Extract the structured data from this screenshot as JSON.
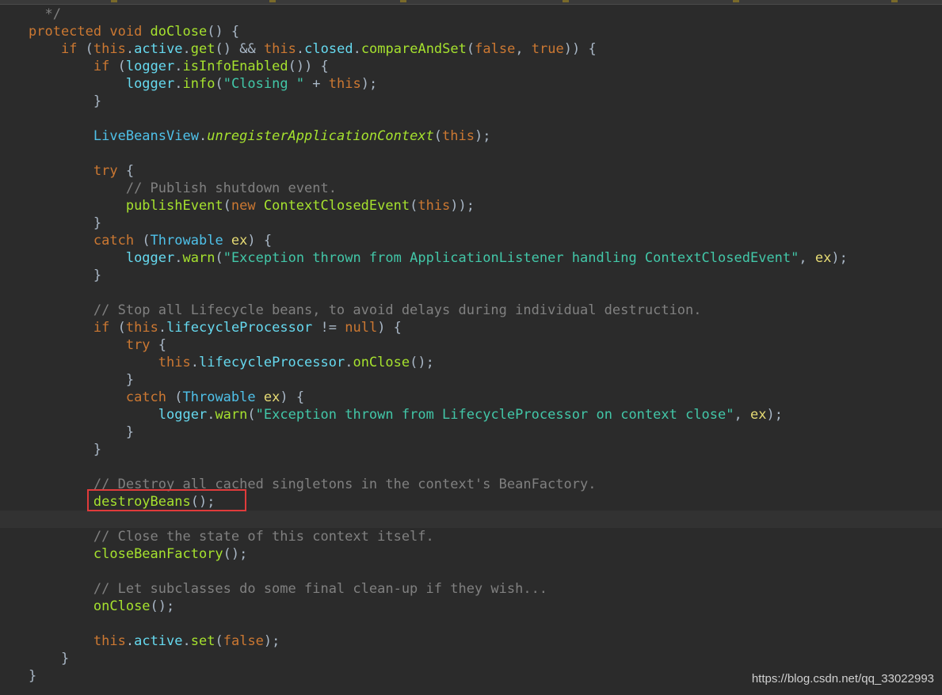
{
  "code_lines": [
    [
      {
        "t": "  */",
        "c": "c"
      }
    ],
    [
      {
        "t": "protected ",
        "c": "k"
      },
      {
        "t": "void ",
        "c": "k"
      },
      {
        "t": "doClose",
        "c": "f"
      },
      {
        "t": "() {",
        "c": "p"
      }
    ],
    [
      {
        "t": "    ",
        "c": "p"
      },
      {
        "t": "if ",
        "c": "k"
      },
      {
        "t": "(",
        "c": "p"
      },
      {
        "t": "this",
        "c": "k"
      },
      {
        "t": ".",
        "c": "p"
      },
      {
        "t": "active",
        "c": "m"
      },
      {
        "t": ".",
        "c": "p"
      },
      {
        "t": "get",
        "c": "f"
      },
      {
        "t": "() && ",
        "c": "p"
      },
      {
        "t": "this",
        "c": "k"
      },
      {
        "t": ".",
        "c": "p"
      },
      {
        "t": "closed",
        "c": "m"
      },
      {
        "t": ".",
        "c": "p"
      },
      {
        "t": "compareAndSet",
        "c": "f"
      },
      {
        "t": "(",
        "c": "p"
      },
      {
        "t": "false",
        "c": "k"
      },
      {
        "t": ", ",
        "c": "p"
      },
      {
        "t": "true",
        "c": "k"
      },
      {
        "t": ")) {",
        "c": "p"
      }
    ],
    [
      {
        "t": "        ",
        "c": "p"
      },
      {
        "t": "if ",
        "c": "k"
      },
      {
        "t": "(",
        "c": "p"
      },
      {
        "t": "logger",
        "c": "m"
      },
      {
        "t": ".",
        "c": "p"
      },
      {
        "t": "isInfoEnabled",
        "c": "f"
      },
      {
        "t": "()) {",
        "c": "p"
      }
    ],
    [
      {
        "t": "            ",
        "c": "p"
      },
      {
        "t": "logger",
        "c": "m"
      },
      {
        "t": ".",
        "c": "p"
      },
      {
        "t": "info",
        "c": "f"
      },
      {
        "t": "(",
        "c": "p"
      },
      {
        "t": "\"Closing \"",
        "c": "s"
      },
      {
        "t": " + ",
        "c": "p"
      },
      {
        "t": "this",
        "c": "k"
      },
      {
        "t": ");",
        "c": "p"
      }
    ],
    [
      {
        "t": "        }",
        "c": "p"
      }
    ],
    [],
    [
      {
        "t": "        ",
        "c": "p"
      },
      {
        "t": "LiveBeansView",
        "c": "t"
      },
      {
        "t": ".",
        "c": "p"
      },
      {
        "t": "unregisterApplicationContext",
        "c": "fi"
      },
      {
        "t": "(",
        "c": "p"
      },
      {
        "t": "this",
        "c": "k"
      },
      {
        "t": ");",
        "c": "p"
      }
    ],
    [],
    [
      {
        "t": "        ",
        "c": "p"
      },
      {
        "t": "try ",
        "c": "k"
      },
      {
        "t": "{",
        "c": "p"
      }
    ],
    [
      {
        "t": "            ",
        "c": "p"
      },
      {
        "t": "// Publish shutdown event.",
        "c": "c"
      }
    ],
    [
      {
        "t": "            ",
        "c": "p"
      },
      {
        "t": "publishEvent",
        "c": "f"
      },
      {
        "t": "(",
        "c": "p"
      },
      {
        "t": "new ",
        "c": "k"
      },
      {
        "t": "ContextClosedEvent",
        "c": "f"
      },
      {
        "t": "(",
        "c": "p"
      },
      {
        "t": "this",
        "c": "k"
      },
      {
        "t": "));",
        "c": "p"
      }
    ],
    [
      {
        "t": "        }",
        "c": "p"
      }
    ],
    [
      {
        "t": "        ",
        "c": "p"
      },
      {
        "t": "catch ",
        "c": "k"
      },
      {
        "t": "(",
        "c": "p"
      },
      {
        "t": "Throwable ",
        "c": "t"
      },
      {
        "t": "ex",
        "c": "v"
      },
      {
        "t": ") {",
        "c": "p"
      }
    ],
    [
      {
        "t": "            ",
        "c": "p"
      },
      {
        "t": "logger",
        "c": "m"
      },
      {
        "t": ".",
        "c": "p"
      },
      {
        "t": "warn",
        "c": "f"
      },
      {
        "t": "(",
        "c": "p"
      },
      {
        "t": "\"Exception thrown from ApplicationListener handling ContextClosedEvent\"",
        "c": "s"
      },
      {
        "t": ", ",
        "c": "p"
      },
      {
        "t": "ex",
        "c": "v"
      },
      {
        "t": ");",
        "c": "p"
      }
    ],
    [
      {
        "t": "        }",
        "c": "p"
      }
    ],
    [],
    [
      {
        "t": "        ",
        "c": "p"
      },
      {
        "t": "// Stop all Lifecycle beans, to avoid delays during individual destruction.",
        "c": "c"
      }
    ],
    [
      {
        "t": "        ",
        "c": "p"
      },
      {
        "t": "if ",
        "c": "k"
      },
      {
        "t": "(",
        "c": "p"
      },
      {
        "t": "this",
        "c": "k"
      },
      {
        "t": ".",
        "c": "p"
      },
      {
        "t": "lifecycleProcessor",
        "c": "m"
      },
      {
        "t": " != ",
        "c": "p"
      },
      {
        "t": "null",
        "c": "k"
      },
      {
        "t": ") {",
        "c": "p"
      }
    ],
    [
      {
        "t": "            ",
        "c": "p"
      },
      {
        "t": "try ",
        "c": "k"
      },
      {
        "t": "{",
        "c": "p"
      }
    ],
    [
      {
        "t": "                ",
        "c": "p"
      },
      {
        "t": "this",
        "c": "k"
      },
      {
        "t": ".",
        "c": "p"
      },
      {
        "t": "lifecycleProcessor",
        "c": "m"
      },
      {
        "t": ".",
        "c": "p"
      },
      {
        "t": "onClose",
        "c": "f"
      },
      {
        "t": "();",
        "c": "p"
      }
    ],
    [
      {
        "t": "            }",
        "c": "p"
      }
    ],
    [
      {
        "t": "            ",
        "c": "p"
      },
      {
        "t": "catch ",
        "c": "k"
      },
      {
        "t": "(",
        "c": "p"
      },
      {
        "t": "Throwable ",
        "c": "t"
      },
      {
        "t": "ex",
        "c": "v"
      },
      {
        "t": ") {",
        "c": "p"
      }
    ],
    [
      {
        "t": "                ",
        "c": "p"
      },
      {
        "t": "logger",
        "c": "m"
      },
      {
        "t": ".",
        "c": "p"
      },
      {
        "t": "warn",
        "c": "f"
      },
      {
        "t": "(",
        "c": "p"
      },
      {
        "t": "\"Exception thrown from LifecycleProcessor on context close\"",
        "c": "s"
      },
      {
        "t": ", ",
        "c": "p"
      },
      {
        "t": "ex",
        "c": "v"
      },
      {
        "t": ");",
        "c": "p"
      }
    ],
    [
      {
        "t": "            }",
        "c": "p"
      }
    ],
    [
      {
        "t": "        }",
        "c": "p"
      }
    ],
    [],
    [
      {
        "t": "        ",
        "c": "p"
      },
      {
        "t": "// Destroy all cached singletons in the context's BeanFactory.",
        "c": "c"
      }
    ],
    [
      {
        "t": "        ",
        "c": "p"
      },
      {
        "t": "destroyBeans",
        "c": "f"
      },
      {
        "t": "();",
        "c": "p"
      }
    ],
    [],
    [
      {
        "t": "        ",
        "c": "p"
      },
      {
        "t": "// Close the state of this context itself.",
        "c": "c"
      }
    ],
    [
      {
        "t": "        ",
        "c": "p"
      },
      {
        "t": "closeBeanFactory",
        "c": "f"
      },
      {
        "t": "();",
        "c": "p"
      }
    ],
    [],
    [
      {
        "t": "        ",
        "c": "p"
      },
      {
        "t": "// Let subclasses do some final clean-up if they wish...",
        "c": "c"
      }
    ],
    [
      {
        "t": "        ",
        "c": "p"
      },
      {
        "t": "onClose",
        "c": "f"
      },
      {
        "t": "();",
        "c": "p"
      }
    ],
    [],
    [
      {
        "t": "        ",
        "c": "p"
      },
      {
        "t": "this",
        "c": "k"
      },
      {
        "t": ".",
        "c": "p"
      },
      {
        "t": "active",
        "c": "m"
      },
      {
        "t": ".",
        "c": "p"
      },
      {
        "t": "set",
        "c": "f"
      },
      {
        "t": "(",
        "c": "p"
      },
      {
        "t": "false",
        "c": "k"
      },
      {
        "t": ");",
        "c": "p"
      }
    ],
    [
      {
        "t": "    }",
        "c": "p"
      }
    ],
    [
      {
        "t": "}",
        "c": "p"
      }
    ]
  ],
  "current_line": 29,
  "highlighted_line": 28,
  "colors": {
    "background": "#2b2b2b",
    "keyword": "#cc7832",
    "method": "#a6e22e",
    "field": "#66d9ef",
    "string": "#42c7a8",
    "comment": "#808080",
    "highlight_box": "#e03b3b"
  },
  "watermark": "https://blog.csdn.net/qq_33022993"
}
